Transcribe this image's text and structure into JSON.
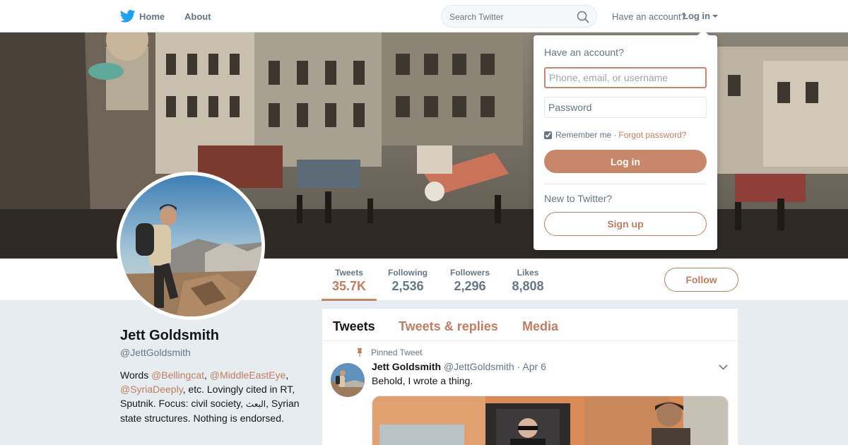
{
  "nav": {
    "home_label": "Home",
    "about_label": "About",
    "search_placeholder": "Search Twitter",
    "have_account": "Have an account?",
    "login_label": "Log in"
  },
  "login_dropdown": {
    "title": "Have an account?",
    "username_placeholder": "Phone, email, or username",
    "password_placeholder": "Password",
    "remember_label": "Remember me",
    "separator": "·",
    "forgot_label": "Forgot password?",
    "login_button": "Log in",
    "new_label": "New to Twitter?",
    "signup_button": "Sign up",
    "remember_checked": true
  },
  "profile": {
    "name": "Jett Goldsmith",
    "handle": "@JettGoldsmith",
    "bio": {
      "p1": "Words ",
      "m1": "@Bellingcat",
      "p2": ", ",
      "m2": "@MiddleEastEye",
      "p3": ", ",
      "m3": "@SyriaDeeply",
      "p4": ", etc. Lovingly cited in RT, Sputnik. Focus: civil society, ",
      "arabic": "البعث",
      "p5": ", Syrian state structures. Nothing is endorsed."
    }
  },
  "stats": [
    {
      "label": "Tweets",
      "value": "35.7K"
    },
    {
      "label": "Following",
      "value": "2,536"
    },
    {
      "label": "Followers",
      "value": "2,296"
    },
    {
      "label": "Likes",
      "value": "8,808"
    }
  ],
  "follow_button": "Follow",
  "timeline": {
    "tabs": [
      "Tweets",
      "Tweets & replies",
      "Media"
    ],
    "pinned_label": "Pinned Tweet",
    "tweet": {
      "name": "Jett Goldsmith",
      "handle": "@JettGoldsmith",
      "separator": "·",
      "date": "Apr 6",
      "text": "Behold, I wrote a thing."
    }
  },
  "colors": {
    "accent": "#c17d60",
    "accent_button": "#c8876a",
    "twitter_blue": "#1da1f2",
    "page_bg": "#e6ecf0"
  }
}
